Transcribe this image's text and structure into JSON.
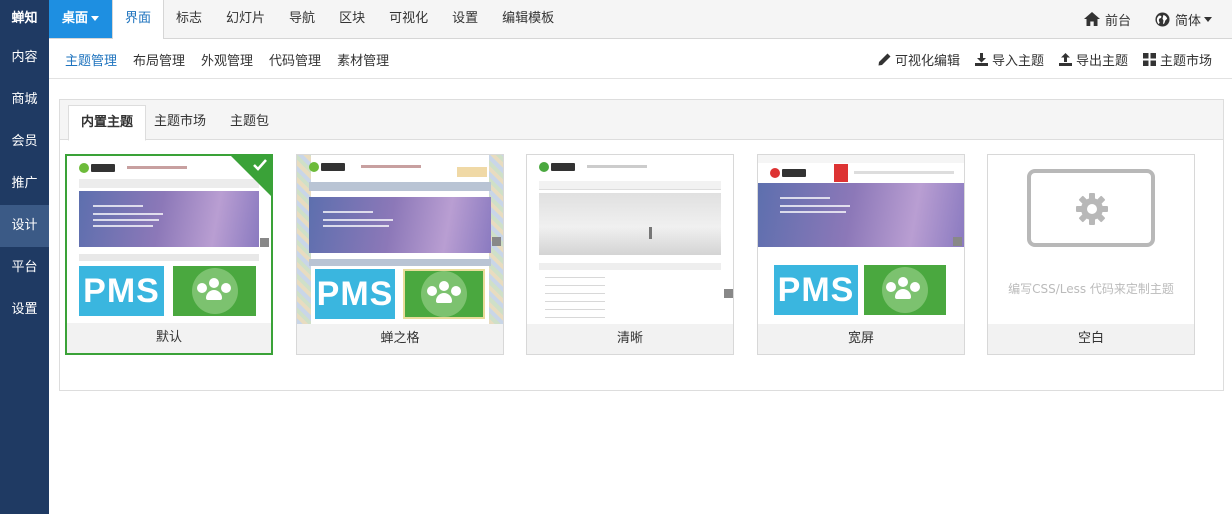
{
  "sidebar": {
    "items": [
      {
        "label": "蝉知"
      },
      {
        "label": "内容"
      },
      {
        "label": "商城"
      },
      {
        "label": "会员"
      },
      {
        "label": "推广"
      },
      {
        "label": "设计",
        "active": true
      },
      {
        "label": "平台"
      },
      {
        "label": "设置"
      }
    ]
  },
  "topbar": {
    "desk_label": "桌面",
    "tabs": [
      {
        "label": "界面",
        "active": true
      },
      {
        "label": "标志"
      },
      {
        "label": "幻灯片"
      },
      {
        "label": "导航"
      },
      {
        "label": "区块"
      },
      {
        "label": "可视化"
      },
      {
        "label": "设置"
      },
      {
        "label": "编辑模板"
      }
    ],
    "front_label": "前台",
    "lang_label": "简体"
  },
  "subnav": {
    "items": [
      {
        "label": "主题管理",
        "active": true
      },
      {
        "label": "布局管理"
      },
      {
        "label": "外观管理"
      },
      {
        "label": "代码管理"
      },
      {
        "label": "素材管理"
      }
    ],
    "actions": [
      {
        "label": "可视化编辑",
        "icon": "pen-icon"
      },
      {
        "label": "导入主题",
        "icon": "download-icon"
      },
      {
        "label": "导出主题",
        "icon": "upload-icon"
      },
      {
        "label": "主题市场",
        "icon": "grid-icon"
      }
    ]
  },
  "panel": {
    "tabs": [
      {
        "label": "内置主题",
        "active": true
      },
      {
        "label": "主题市场"
      },
      {
        "label": "主题包"
      }
    ],
    "themes": [
      {
        "name": "默认",
        "selected": true
      },
      {
        "name": "蝉之格"
      },
      {
        "name": "清晰"
      },
      {
        "name": "宽屏"
      },
      {
        "name": "空白",
        "hint": "编写CSS/Less 代码来定制主题"
      }
    ],
    "thumb_text": "PMS"
  },
  "colors": {
    "sidebar": "#1f3a63",
    "accent": "#1e8fe1",
    "link": "#1e73be",
    "selected": "#3aa238"
  }
}
